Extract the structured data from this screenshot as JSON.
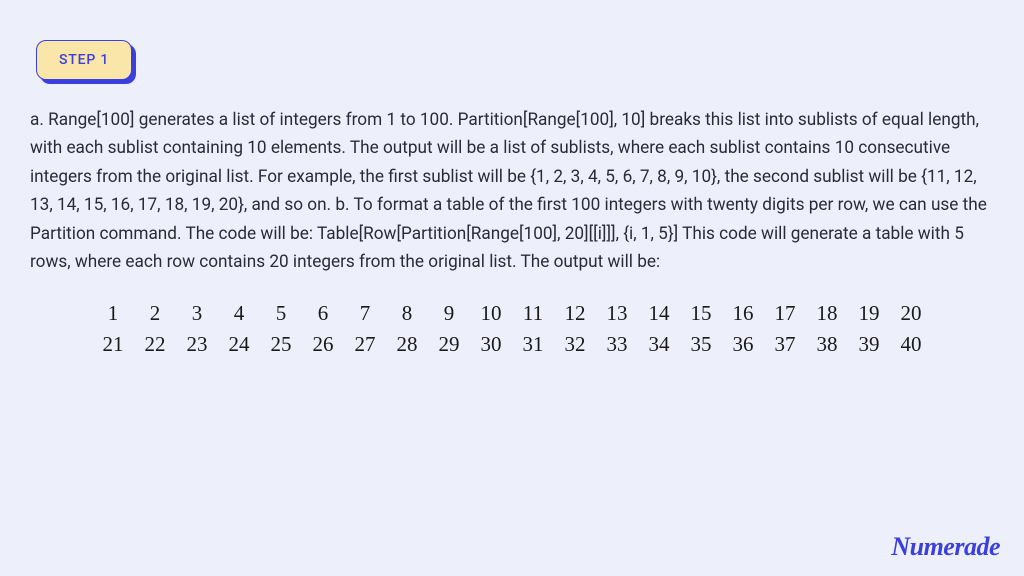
{
  "step": {
    "label": "STEP 1"
  },
  "body": "a. Range[100] generates a list of integers from 1 to 100. Partition[Range[100], 10] breaks this list into sublists of equal length, with each sublist containing 10 elements. The output will be a list of sublists, where each sublist contains 10 consecutive integers from the original list. For example, the first sublist will be {1, 2, 3, 4, 5, 6, 7, 8, 9, 10}, the second sublist will be {11, 12, 13, 14, 15, 16, 17, 18, 19, 20}, and so on. b. To format a table of the first 100 integers with twenty digits per row, we can use the Partition command. The code will be: Table[Row[Partition[Range[100], 20][[i]]], {i, 1, 5}] This code will generate a table with 5 rows, where each row contains 20 integers from the original list. The output will be:",
  "chart_data": {
    "type": "table",
    "title": "",
    "rows": [
      [
        "1",
        "2",
        "3",
        "4",
        "5",
        "6",
        "7",
        "8",
        "9",
        "10",
        "11",
        "12",
        "13",
        "14",
        "15",
        "16",
        "17",
        "18",
        "19",
        "20"
      ],
      [
        "21",
        "22",
        "23",
        "24",
        "25",
        "26",
        "27",
        "28",
        "29",
        "30",
        "31",
        "32",
        "33",
        "34",
        "35",
        "36",
        "37",
        "38",
        "39",
        "40"
      ]
    ]
  },
  "brand": "Numerade"
}
